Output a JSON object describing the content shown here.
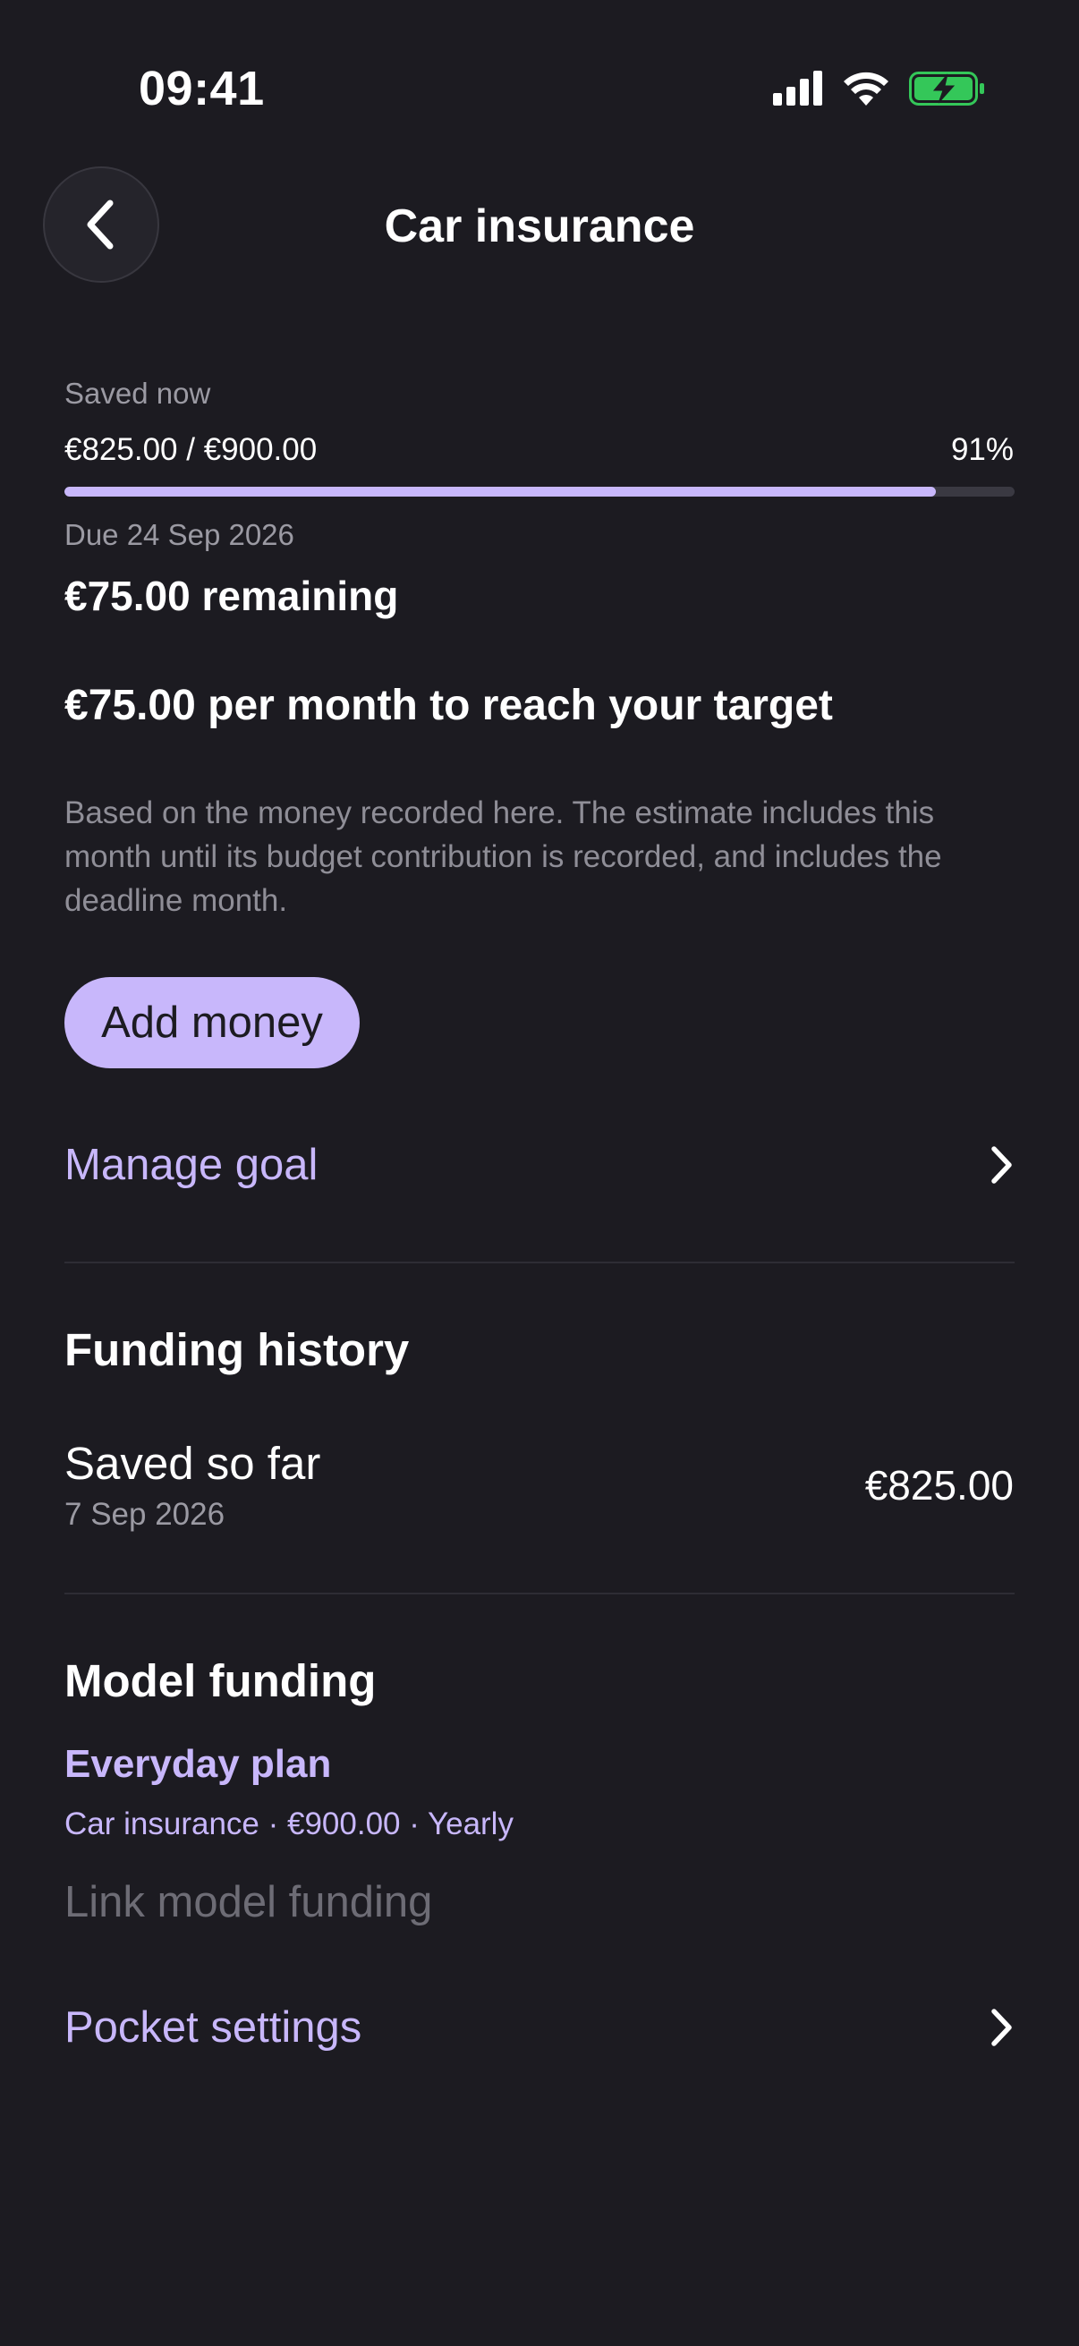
{
  "status_bar": {
    "time": "09:41"
  },
  "header": {
    "title": "Car insurance"
  },
  "progress": {
    "label": "Saved now",
    "amounts": "€825.00 / €900.00",
    "percent_text": "91%",
    "fraction": 0.917,
    "due": "Due 24 Sep 2026",
    "remaining": "€75.00 remaining",
    "per_month": "€75.00 per month to reach your target",
    "note": "Based on the money recorded here. The estimate includes this month until its budget contribution is recorded, and includes the deadline month."
  },
  "actions": {
    "add_money": "Add money",
    "manage_goal": "Manage goal"
  },
  "funding_history": {
    "title": "Funding history",
    "entries": [
      {
        "label": "Saved so far",
        "date": "7 Sep 2026",
        "amount": "€825.00"
      }
    ]
  },
  "model_funding": {
    "title": "Model funding",
    "plan_name": "Everyday plan",
    "plan_details": "Car insurance · €900.00 · Yearly",
    "link_label": "Link model funding"
  },
  "pocket_settings": {
    "label": "Pocket settings"
  },
  "colors": {
    "background": "#1c1b21",
    "accent": "#c8b7fb",
    "muted_text": "#9b9aa3",
    "battery": "#34c759"
  },
  "icons": {
    "back": "chevron-left-icon",
    "row_arrow": "chevron-right-icon",
    "signal": "cellular-signal-icon",
    "wifi": "wifi-icon",
    "battery": "battery-charging-icon"
  }
}
